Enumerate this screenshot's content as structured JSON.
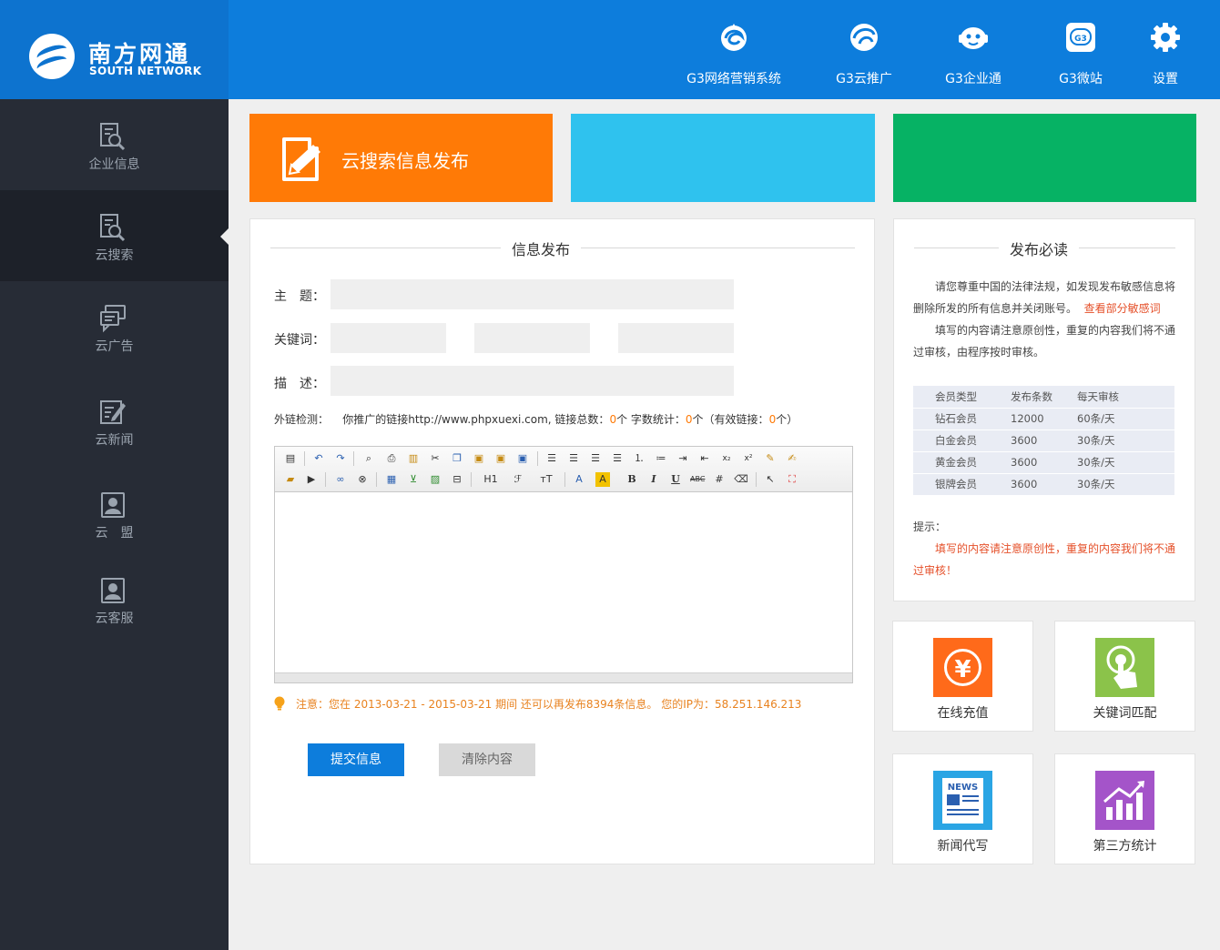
{
  "brand": {
    "name_cn": "南方网通",
    "name_en": "SOUTH NETWORK"
  },
  "topnav": [
    {
      "label": "G3网络营销系统",
      "icon": "swirl-logo-icon"
    },
    {
      "label": "G3云推广",
      "icon": "cloud-promo-icon"
    },
    {
      "label": "G3企业通",
      "icon": "robot-face-icon"
    },
    {
      "label": "G3微站",
      "icon": "g3-badge-icon",
      "badge": "G3"
    },
    {
      "label": "设置",
      "icon": "gear-icon"
    }
  ],
  "sidebar": {
    "items": [
      {
        "label": "企业信息",
        "icon": "document-search-icon"
      },
      {
        "label": "云搜索",
        "icon": "document-search-icon",
        "active": true
      },
      {
        "label": "云广告",
        "icon": "chat-bubbles-icon"
      },
      {
        "label": "云新闻",
        "icon": "edit-document-icon"
      },
      {
        "label": "云　盟",
        "icon": "contact-card-icon"
      },
      {
        "label": "云客服",
        "icon": "contact-card-icon"
      }
    ]
  },
  "tiles": {
    "orange_label": "云搜索信息发布"
  },
  "form": {
    "section_title": "信息发布",
    "subject_label": "主　题：",
    "subject_value": "",
    "keywords_label": "关键词：",
    "keywords_values": [
      "",
      "",
      ""
    ],
    "description_label": "描　述：",
    "description_value": "",
    "ext_label": "外链检测：",
    "ext_prefix": "你推广的链接http://www.phpxuexi.com, 链接总数：",
    "ext_total": "0",
    "ext_mid": "个  字数统计：",
    "ext_words": "0",
    "ext_mid2": "个（有效链接：",
    "ext_valid": "0",
    "ext_suffix": "个）",
    "notice": "注意：您在 2013-03-21 - 2015-03-21 期间 还可以再发布8394条信息。 您的IP为：58.251.146.213",
    "submit_label": "提交信息",
    "clear_label": "清除内容"
  },
  "editor": {
    "toolbar_text": {
      "h1": "H1",
      "font": "ℱ",
      "size": "ᴛT",
      "fontcolor": "A",
      "bgcolor": "A",
      "bold": "B",
      "italic": "I",
      "underline": "U",
      "strike": "ABC",
      "sub": "x₂",
      "sup": "x²"
    }
  },
  "notice_panel": {
    "title": "发布必读",
    "para1": "请您尊重中国的法律法规，如发现发布敏感信息将删除所发的所有信息并关闭账号。",
    "para1_link": "查看部分敏感词",
    "para2": "填写的内容请注意原创性，重复的内容我们将不通过审核，由程序按时审核。",
    "table_headers": [
      "会员类型",
      "发布条数",
      "每天审核"
    ],
    "table_rows": [
      [
        "钻石会员",
        "12000",
        "60条/天"
      ],
      [
        "白金会员",
        "3600",
        "30条/天"
      ],
      [
        "黄金会员",
        "3600",
        "30条/天"
      ],
      [
        "银牌会员",
        "3600",
        "30条/天"
      ]
    ],
    "tip_label": "提示：",
    "tip_text": "填写的内容请注意原创性，重复的内容我们将不通过审核！"
  },
  "quick_tiles": [
    {
      "label": "在线充值",
      "icon": "yen-coin-icon",
      "color": "#ff6a1a"
    },
    {
      "label": "关键词匹配",
      "icon": "touch-hand-icon",
      "color": "#8bc34a"
    },
    {
      "label": "新闻代写",
      "icon": "news-icon",
      "color": "#2aa5e4",
      "badge": "NEWS"
    },
    {
      "label": "第三方统计",
      "icon": "bar-growth-icon",
      "color": "#a454c9"
    }
  ],
  "colors": {
    "header_blue": "#0d7ddc",
    "logo_blue": "#0d73cf",
    "sidebar_bg": "#272c36",
    "orange": "#ff7a06",
    "sky": "#2fc2ee",
    "green": "#06b264",
    "warn": "#e5502a"
  }
}
